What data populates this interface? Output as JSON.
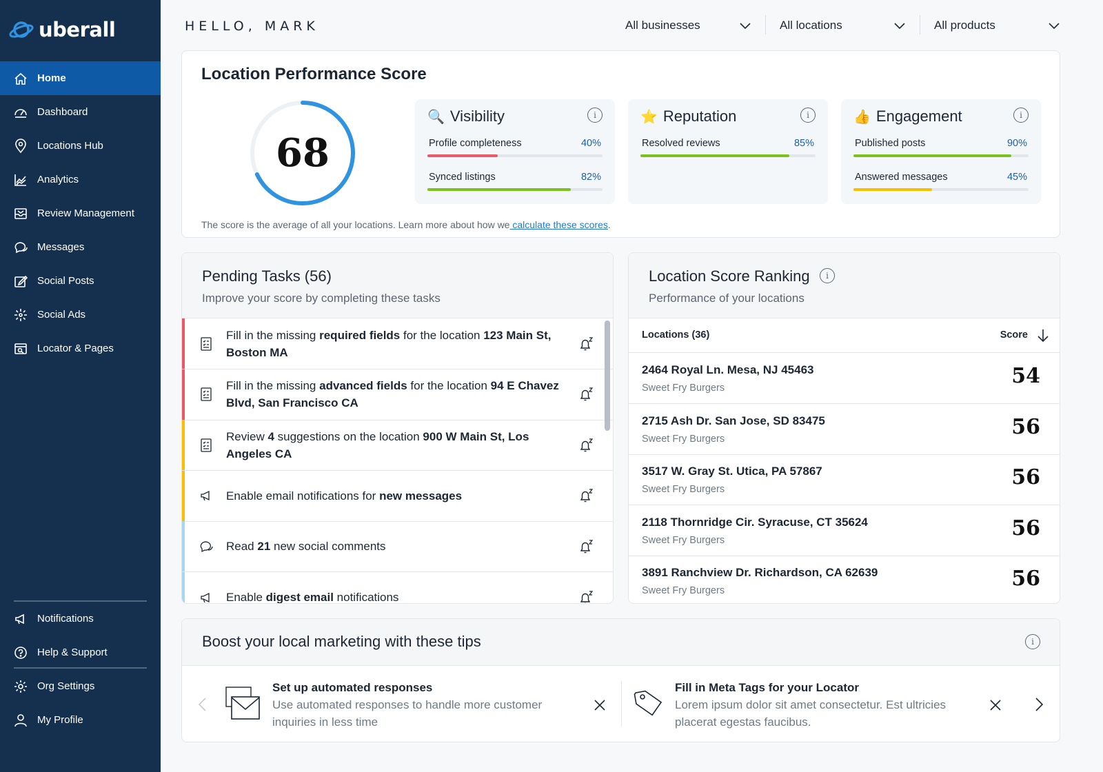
{
  "brand": {
    "name": "uberall"
  },
  "sidebar": {
    "items": [
      {
        "label": "Home",
        "icon": "home-icon"
      },
      {
        "label": "Dashboard",
        "icon": "gauge-icon"
      },
      {
        "label": "Locations Hub",
        "icon": "pin-icon"
      },
      {
        "label": "Analytics",
        "icon": "analytics-icon"
      },
      {
        "label": "Review Management",
        "icon": "inbox-icon"
      },
      {
        "label": "Messages",
        "icon": "chat-icon"
      },
      {
        "label": "Social Posts",
        "icon": "edit-icon"
      },
      {
        "label": "Social Ads",
        "icon": "sparkle-icon"
      },
      {
        "label": "Locator & Pages",
        "icon": "locator-icon"
      }
    ],
    "bottom_items": [
      {
        "label": "Notifications",
        "icon": "megaphone-icon"
      },
      {
        "label": "Help & Support",
        "icon": "help-icon"
      },
      {
        "label": "Org Settings",
        "icon": "gear-icon"
      },
      {
        "label": "My Profile",
        "icon": "user-icon"
      }
    ]
  },
  "header": {
    "greeting": "HELLO, MARK",
    "filters": [
      "All businesses",
      "All locations",
      "All products"
    ]
  },
  "lps": {
    "title": "Location Performance Score",
    "score": "68",
    "score_value": 68,
    "note_prefix": "The score is the average of all your locations. Learn more about how we",
    "note_link": " calculate these scores",
    "note_suffix": ".",
    "metrics": [
      {
        "title": "Visibility",
        "emoji": "🔍",
        "rows": [
          {
            "label": "Profile completeness",
            "pct": "40%",
            "value": 40,
            "color": "#e85a6a"
          },
          {
            "label": "Synced listings",
            "pct": "82%",
            "value": 82,
            "color": "#7cc21f"
          }
        ]
      },
      {
        "title": "Reputation",
        "emoji": "⭐",
        "rows": [
          {
            "label": "Resolved reviews",
            "pct": "85%",
            "value": 85,
            "color": "#7cc21f"
          }
        ]
      },
      {
        "title": "Engagement",
        "emoji": "👍",
        "rows": [
          {
            "label": "Published posts",
            "pct": "90%",
            "value": 90,
            "color": "#7cc21f"
          },
          {
            "label": "Answered messages",
            "pct": "45%",
            "value": 45,
            "color": "#f5c000"
          }
        ]
      }
    ],
    "ring_color": "#2e93e0"
  },
  "tasks": {
    "title": "Pending Tasks (56)",
    "subtitle": "Improve your score by completing these tasks",
    "items": [
      {
        "stripe": "#e85a6a",
        "icon": "checklist-icon",
        "parts": [
          [
            "Fill in the missing ",
            false
          ],
          [
            "required fields",
            true
          ],
          [
            " for the location ",
            false
          ],
          [
            "123 Main St, Boston MA",
            true
          ]
        ]
      },
      {
        "stripe": "#e85a6a",
        "icon": "checklist-icon",
        "parts": [
          [
            "Fill in the missing ",
            false
          ],
          [
            "advanced fields",
            true
          ],
          [
            " for the location ",
            false
          ],
          [
            "94 E Chavez Blvd, San Francisco CA",
            true
          ]
        ]
      },
      {
        "stripe": "#f5c000",
        "icon": "checklist-icon",
        "parts": [
          [
            "Review ",
            false
          ],
          [
            "4",
            true
          ],
          [
            " suggestions on the location ",
            false
          ],
          [
            "900 W Main St, Los Angeles CA",
            true
          ]
        ]
      },
      {
        "stripe": "#f5c000",
        "icon": "megaphone-icon",
        "parts": [
          [
            "Enable email notifications for ",
            false
          ],
          [
            "new messages",
            true
          ]
        ]
      },
      {
        "stripe": "#a9d6ef",
        "icon": "chat-icon",
        "parts": [
          [
            "Read ",
            false
          ],
          [
            "21",
            true
          ],
          [
            " new social comments",
            false
          ]
        ]
      },
      {
        "stripe": "#a9d6ef",
        "icon": "megaphone-icon",
        "parts": [
          [
            "Enable ",
            false
          ],
          [
            "digest email",
            true
          ],
          [
            " notifications",
            false
          ]
        ]
      }
    ]
  },
  "ranking": {
    "title": "Location Score Ranking",
    "subtitle": "Performance of your locations",
    "col_locations": "Locations (36)",
    "col_score": "Score",
    "rows": [
      {
        "address": "2464 Royal Ln. Mesa, NJ 45463",
        "business": "Sweet Fry Burgers",
        "score": "54"
      },
      {
        "address": "2715 Ash Dr. San Jose, SD 83475",
        "business": "Sweet Fry Burgers",
        "score": "56"
      },
      {
        "address": "3517 W. Gray St. Utica, PA 57867",
        "business": "Sweet Fry Burgers",
        "score": "56"
      },
      {
        "address": "2118 Thornridge Cir. Syracuse, CT 35624",
        "business": "Sweet Fry Burgers",
        "score": "56"
      },
      {
        "address": "3891 Ranchview Dr. Richardson, CA 62639",
        "business": "Sweet Fry Burgers",
        "score": "56"
      }
    ]
  },
  "tips": {
    "title": "Boost your local marketing with these tips",
    "items": [
      {
        "title": "Set up automated responses",
        "desc": "Use automated responses to handle more customer inquiries in less time",
        "icon": "envelope-icon"
      },
      {
        "title": "Fill in Meta Tags for your Locator",
        "desc": "Lorem ipsum dolor sit amet consectetur. Est ultricies placerat egestas faucibus.",
        "icon": "tag-icon"
      }
    ]
  }
}
